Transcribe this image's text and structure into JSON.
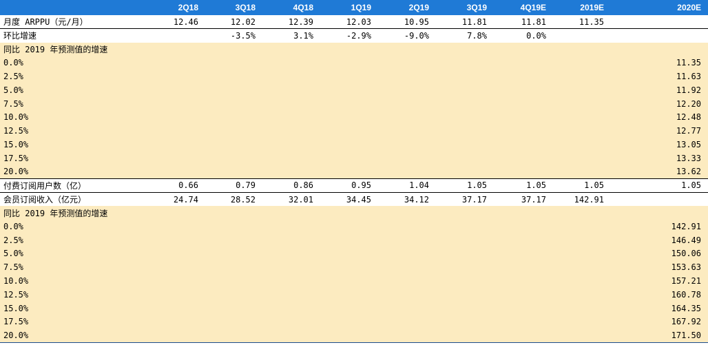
{
  "header": {
    "columns": [
      "",
      "2Q18",
      "3Q18",
      "4Q18",
      "1Q19",
      "2Q19",
      "3Q19",
      "4Q19E",
      "2019E",
      "2020E"
    ]
  },
  "rows": [
    {
      "label": "月度 ARPPU（元/月）",
      "values": [
        "12.46",
        "12.02",
        "12.39",
        "12.03",
        "10.95",
        "11.81",
        "11.81",
        "11.35",
        ""
      ]
    },
    {
      "label": "环比增速",
      "values": [
        "",
        "-3.5%",
        "3.1%",
        "-2.9%",
        "-9.0%",
        "7.8%",
        "0.0%",
        "",
        ""
      ]
    },
    {
      "label": "同比 2019 年预测值的增速",
      "values": [
        "",
        "",
        "",
        "",
        "",
        "",
        "",
        "",
        ""
      ]
    },
    {
      "label": "0.0%",
      "values": [
        "",
        "",
        "",
        "",
        "",
        "",
        "",
        "",
        "11.35"
      ]
    },
    {
      "label": "2.5%",
      "values": [
        "",
        "",
        "",
        "",
        "",
        "",
        "",
        "",
        "11.63"
      ]
    },
    {
      "label": "5.0%",
      "values": [
        "",
        "",
        "",
        "",
        "",
        "",
        "",
        "",
        "11.92"
      ]
    },
    {
      "label": "7.5%",
      "values": [
        "",
        "",
        "",
        "",
        "",
        "",
        "",
        "",
        "12.20"
      ]
    },
    {
      "label": "10.0%",
      "values": [
        "",
        "",
        "",
        "",
        "",
        "",
        "",
        "",
        "12.48"
      ]
    },
    {
      "label": "12.5%",
      "values": [
        "",
        "",
        "",
        "",
        "",
        "",
        "",
        "",
        "12.77"
      ]
    },
    {
      "label": "15.0%",
      "values": [
        "",
        "",
        "",
        "",
        "",
        "",
        "",
        "",
        "13.05"
      ]
    },
    {
      "label": "17.5%",
      "values": [
        "",
        "",
        "",
        "",
        "",
        "",
        "",
        "",
        "13.33"
      ]
    },
    {
      "label": "20.0%",
      "values": [
        "",
        "",
        "",
        "",
        "",
        "",
        "",
        "",
        "13.62"
      ]
    },
    {
      "label": "付费订阅用户数（亿）",
      "values": [
        "0.66",
        "0.79",
        "0.86",
        "0.95",
        "1.04",
        "1.05",
        "1.05",
        "1.05",
        "1.05"
      ]
    },
    {
      "label": "会员订阅收入（亿元）",
      "values": [
        "24.74",
        "28.52",
        "32.01",
        "34.45",
        "34.12",
        "37.17",
        "37.17",
        "142.91",
        ""
      ]
    },
    {
      "label": "同比 2019 年预测值的增速",
      "values": [
        "",
        "",
        "",
        "",
        "",
        "",
        "",
        "",
        ""
      ]
    },
    {
      "label": "0.0%",
      "values": [
        "",
        "",
        "",
        "",
        "",
        "",
        "",
        "",
        "142.91"
      ]
    },
    {
      "label": "2.5%",
      "values": [
        "",
        "",
        "",
        "",
        "",
        "",
        "",
        "",
        "146.49"
      ]
    },
    {
      "label": "5.0%",
      "values": [
        "",
        "",
        "",
        "",
        "",
        "",
        "",
        "",
        "150.06"
      ]
    },
    {
      "label": "7.5%",
      "values": [
        "",
        "",
        "",
        "",
        "",
        "",
        "",
        "",
        "153.63"
      ]
    },
    {
      "label": "10.0%",
      "values": [
        "",
        "",
        "",
        "",
        "",
        "",
        "",
        "",
        "157.21"
      ]
    },
    {
      "label": "12.5%",
      "values": [
        "",
        "",
        "",
        "",
        "",
        "",
        "",
        "",
        "160.78"
      ]
    },
    {
      "label": "15.0%",
      "values": [
        "",
        "",
        "",
        "",
        "",
        "",
        "",
        "",
        "164.35"
      ]
    },
    {
      "label": "17.5%",
      "values": [
        "",
        "",
        "",
        "",
        "",
        "",
        "",
        "",
        "167.92"
      ]
    },
    {
      "label": "20.0%",
      "values": [
        "",
        "",
        "",
        "",
        "",
        "",
        "",
        "",
        "171.50"
      ]
    }
  ],
  "colors": {
    "header_bg": "#1f7ad6",
    "highlight_bg": "#fcebc0"
  }
}
